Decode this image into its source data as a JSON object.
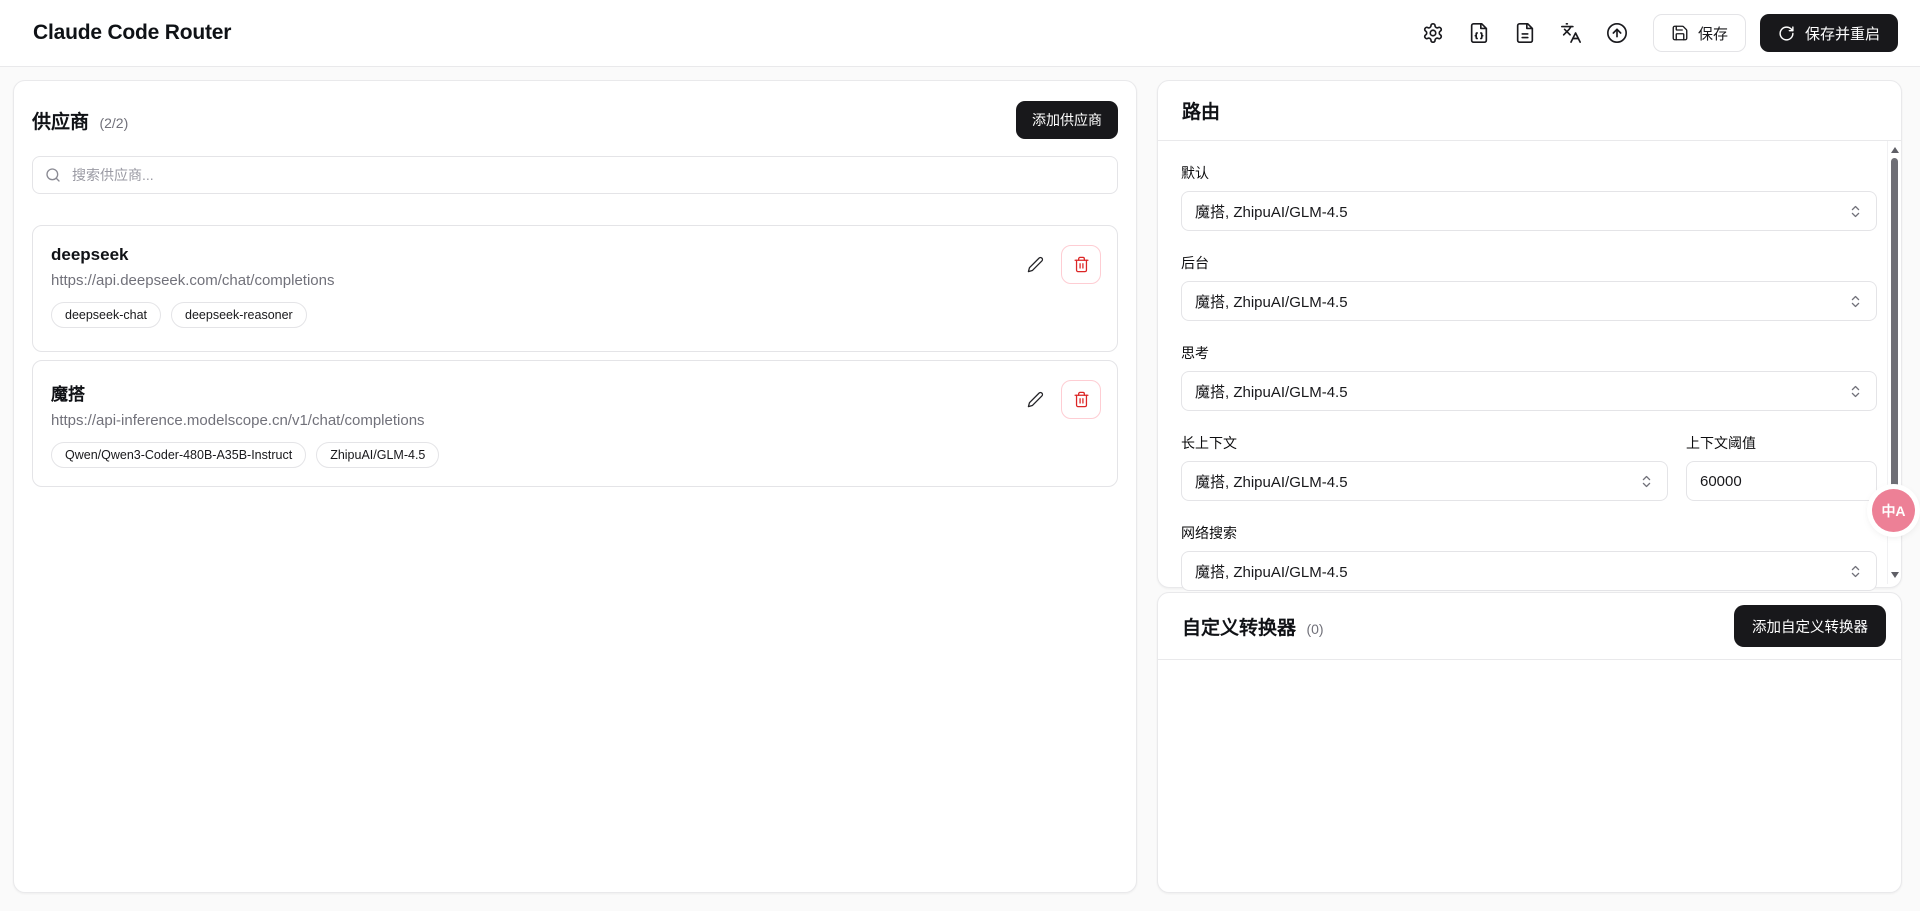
{
  "header": {
    "title": "Claude Code Router",
    "save_label": "保存",
    "save_restart_label": "保存并重启",
    "icon_buttons": [
      "settings",
      "json-config",
      "log-file",
      "translate",
      "update"
    ]
  },
  "providers": {
    "title": "供应商",
    "count": "(2/2)",
    "add_button": "添加供应商",
    "search_placeholder": "搜索供应商...",
    "items": [
      {
        "name": "deepseek",
        "url": "https://api.deepseek.com/chat/completions",
        "models": [
          "deepseek-chat",
          "deepseek-reasoner"
        ]
      },
      {
        "name": "魔搭",
        "url": "https://api-inference.modelscope.cn/v1/chat/completions",
        "models": [
          "Qwen/Qwen3-Coder-480B-A35B-Instruct",
          "ZhipuAI/GLM-4.5"
        ]
      }
    ]
  },
  "router": {
    "title": "路由",
    "fields": [
      {
        "label": "默认",
        "value": "魔搭, ZhipuAI/GLM-4.5"
      },
      {
        "label": "后台",
        "value": "魔搭, ZhipuAI/GLM-4.5"
      },
      {
        "label": "思考",
        "value": "魔搭, ZhipuAI/GLM-4.5"
      },
      {
        "label": "长上下文",
        "value": "魔搭, ZhipuAI/GLM-4.5"
      },
      {
        "label": "网络搜索",
        "value": "魔搭, ZhipuAI/GLM-4.5"
      }
    ],
    "threshold": {
      "label": "上下文阈值",
      "value": "60000"
    }
  },
  "transformers": {
    "title": "自定义转换器",
    "count": "(0)",
    "add_button": "添加自定义转换器"
  },
  "fab": {
    "label": "中A"
  },
  "colors": {
    "accent_dark": "#18181b",
    "danger": "#dc2626",
    "danger_border": "#fecdd3",
    "muted_text": "#71717a",
    "border": "#e4e4e7",
    "page_bg": "#fafafa",
    "fab_pink": "#ed8096"
  }
}
